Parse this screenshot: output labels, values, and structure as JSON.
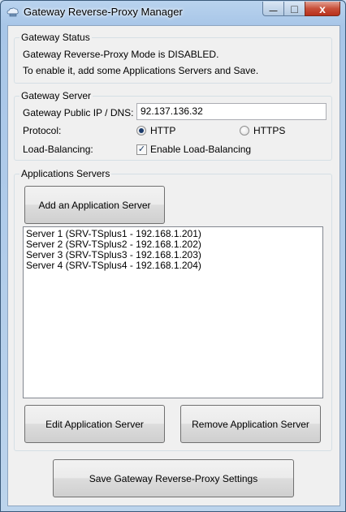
{
  "window": {
    "title": "Gateway Reverse-Proxy Manager",
    "minimize_glyph": "—",
    "maximize_glyph": "□",
    "close_glyph": "x"
  },
  "status": {
    "group_label": "Gateway Status",
    "line1": "Gateway Reverse-Proxy Mode is DISABLED.",
    "line2": "To enable it, add some Applications Servers and Save."
  },
  "server": {
    "group_label": "Gateway Server",
    "ip_label": "Gateway Public IP / DNS:",
    "ip_value": "92.137.136.32",
    "protocol_label": "Protocol:",
    "protocol_options": [
      "HTTP",
      "HTTPS"
    ],
    "protocol_selected": "HTTP",
    "lb_label": "Load-Balancing:",
    "lb_checkbox_label": "Enable Load-Balancing",
    "lb_checked": true
  },
  "apps": {
    "group_label": "Applications Servers",
    "add_button": "Add an Application Server",
    "servers": [
      "Server 1 (SRV-TSplus1 - 192.168.1.201)",
      "Server 2 (SRV-TSplus2 - 192.168.1.202)",
      "Server 3 (SRV-TSplus3 - 192.168.1.203)",
      "Server 4 (SRV-TSplus4 - 192.168.1.204)"
    ],
    "edit_button": "Edit Application Server",
    "remove_button": "Remove Application Server"
  },
  "footer": {
    "save_button": "Save Gateway Reverse-Proxy Settings"
  }
}
